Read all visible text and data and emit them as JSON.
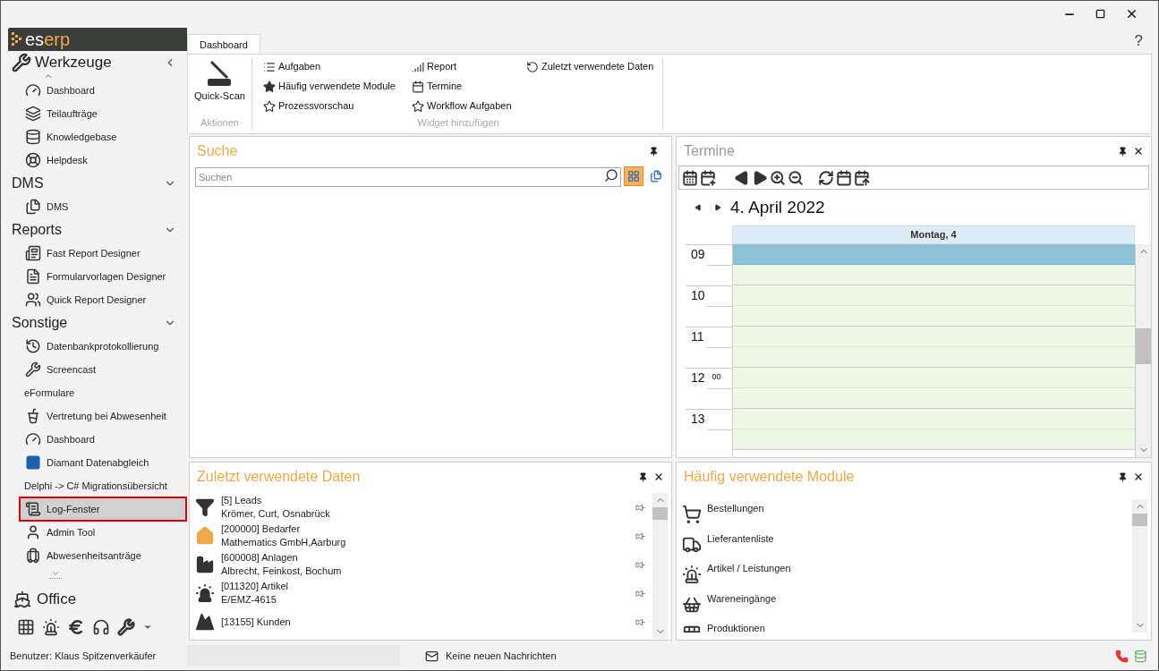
{
  "sidebar": {
    "logo": {
      "part_1": "es",
      "part_2": "erp"
    },
    "sections": [
      {
        "title": "Werkzeuge",
        "kind": "main",
        "items": [
          {
            "label": "Dashboard",
            "kind": "icon",
            "selected": false
          },
          {
            "label": "Teilaufträge",
            "kind": "icon",
            "selected": false
          },
          {
            "label": "Knowledgebase",
            "kind": "icon",
            "selected": false
          },
          {
            "label": "Helpdesk",
            "kind": "icon",
            "selected": false
          }
        ]
      },
      {
        "title": "DMS",
        "kind": "group",
        "items": [
          {
            "label": "DMS",
            "kind": "icon",
            "selected": false
          }
        ]
      },
      {
        "title": "Reports",
        "kind": "group",
        "items": [
          {
            "label": "Fast Report Designer",
            "kind": "icon",
            "selected": false
          },
          {
            "label": "Formularvorlagen Designer",
            "kind": "icon",
            "selected": false
          },
          {
            "label": "Quick Report Designer",
            "kind": "icon",
            "selected": false
          }
        ]
      },
      {
        "title": "Sonstige",
        "kind": "group",
        "items": [
          {
            "label": "Datenbankprotokollierung",
            "kind": "icon",
            "selected": false
          },
          {
            "label": "Screencast",
            "kind": "icon",
            "selected": false
          },
          {
            "label": "eFormulare",
            "kind": "text",
            "selected": false
          },
          {
            "label": "Vertretung bei Abwesenheit",
            "kind": "icon",
            "selected": false
          },
          {
            "label": "Dashboard",
            "kind": "icon",
            "selected": false
          },
          {
            "label": "Diamant Datenabgleich",
            "kind": "icon",
            "selected": false
          },
          {
            "label": "Delphi -> C# Migrationsübersicht",
            "kind": "text",
            "selected": false
          },
          {
            "label": "Log-Fenster",
            "kind": "icon",
            "selected": true
          },
          {
            "label": "Admin Tool",
            "kind": "icon",
            "selected": false
          },
          {
            "label": "Abwesenheitsanträge",
            "kind": "icon",
            "selected": false
          }
        ]
      }
    ],
    "office": "Office"
  },
  "ribbon": {
    "tabs": [
      {
        "label": "Dashboard",
        "selected": true
      }
    ],
    "help": "?",
    "groups": [
      {
        "title": "Aktionen",
        "buttons": [
          "Quick-Scan"
        ]
      },
      {
        "title": "Widget hinzufügen",
        "columns": [
          [
            "Aufgaben",
            "Häufig verwendete Module",
            "Prozessvorschau"
          ],
          [
            "Report",
            "Termine",
            "Workflow Aufgaben"
          ],
          [
            "Zuletzt verwendete Daten"
          ]
        ]
      }
    ]
  },
  "search_panel": {
    "title": "Suche",
    "placeholder": "Suchen",
    "filters": [
      {
        "selected": true
      },
      {
        "selected": false
      }
    ]
  },
  "calendar_panel": {
    "title": "Termine",
    "date": "4. April 2022",
    "day": "Montag, 4",
    "hours": [
      "09",
      "10",
      "11",
      "12",
      "13"
    ],
    "minutes_label": "00",
    "slots": [
      {
        "selected": true
      },
      {
        "selected": false
      },
      {
        "selected": false
      },
      {
        "selected": false
      },
      {
        "selected": false
      },
      {
        "selected": false
      },
      {
        "selected": false
      },
      {
        "selected": false
      },
      {
        "selected": false
      },
      {
        "selected": false
      }
    ]
  },
  "recent_panel": {
    "title": "Zuletzt verwendete Daten",
    "items": [
      {
        "title": "[5] Leads",
        "subtitle": "Krömer, Curt, Osnabrück"
      },
      {
        "title": "[200000] Bedarfer",
        "subtitle": "Mathematics GmbH,Aarburg"
      },
      {
        "title": "[600008] Anlagen",
        "subtitle": "Albrecht, Feinkost, Bochum"
      },
      {
        "title": "[011320] Artikel",
        "subtitle": "E/EMZ-4615"
      },
      {
        "title": "[13155] Kunden"
      }
    ]
  },
  "modules_panel": {
    "title": "Häufig verwendete Module",
    "items": [
      "Bestellungen",
      "Lieferantenliste",
      "Artikel / Leistungen",
      "Wareneingänge",
      "Produktionen"
    ]
  },
  "status_bar": {
    "user": "Benutzer: Klaus Spitzenverkäufer",
    "messages": "Keine neuen Nachrichten"
  }
}
